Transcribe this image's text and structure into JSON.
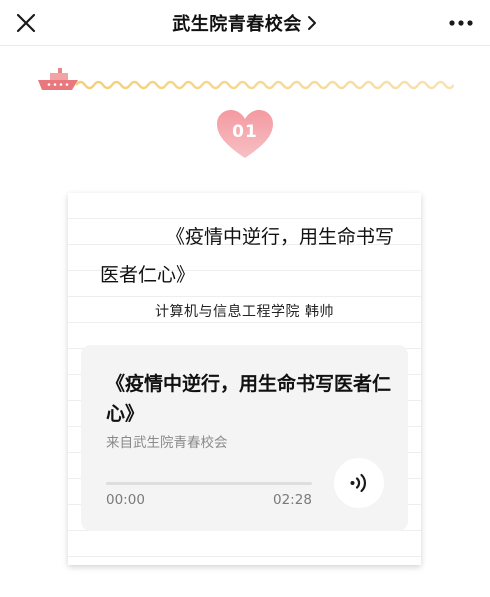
{
  "nav": {
    "title": "武生院青春校会",
    "close_icon": "close-icon",
    "chevron_icon": "chevron-right-icon",
    "more_icon": "more-dots-icon"
  },
  "decor": {
    "boat_icon": "boat-icon",
    "wave_icon": "wave-line-icon",
    "wave_colors": [
      "#f6d27a",
      "#f8dfa5"
    ],
    "heart_color": "#f5a4aa",
    "section_number": "01"
  },
  "article": {
    "title": "《疫情中逆行，用生命书写医者仁心》",
    "author_line": "计算机与信息工程学院 韩帅"
  },
  "audio": {
    "title": "《疫情中逆行，用生命书写医者仁心》",
    "source": "来自武生院青春校会",
    "current_time": "00:00",
    "total_time": "02:28",
    "progress": 0,
    "play_icon": "sound-wave-icon"
  }
}
